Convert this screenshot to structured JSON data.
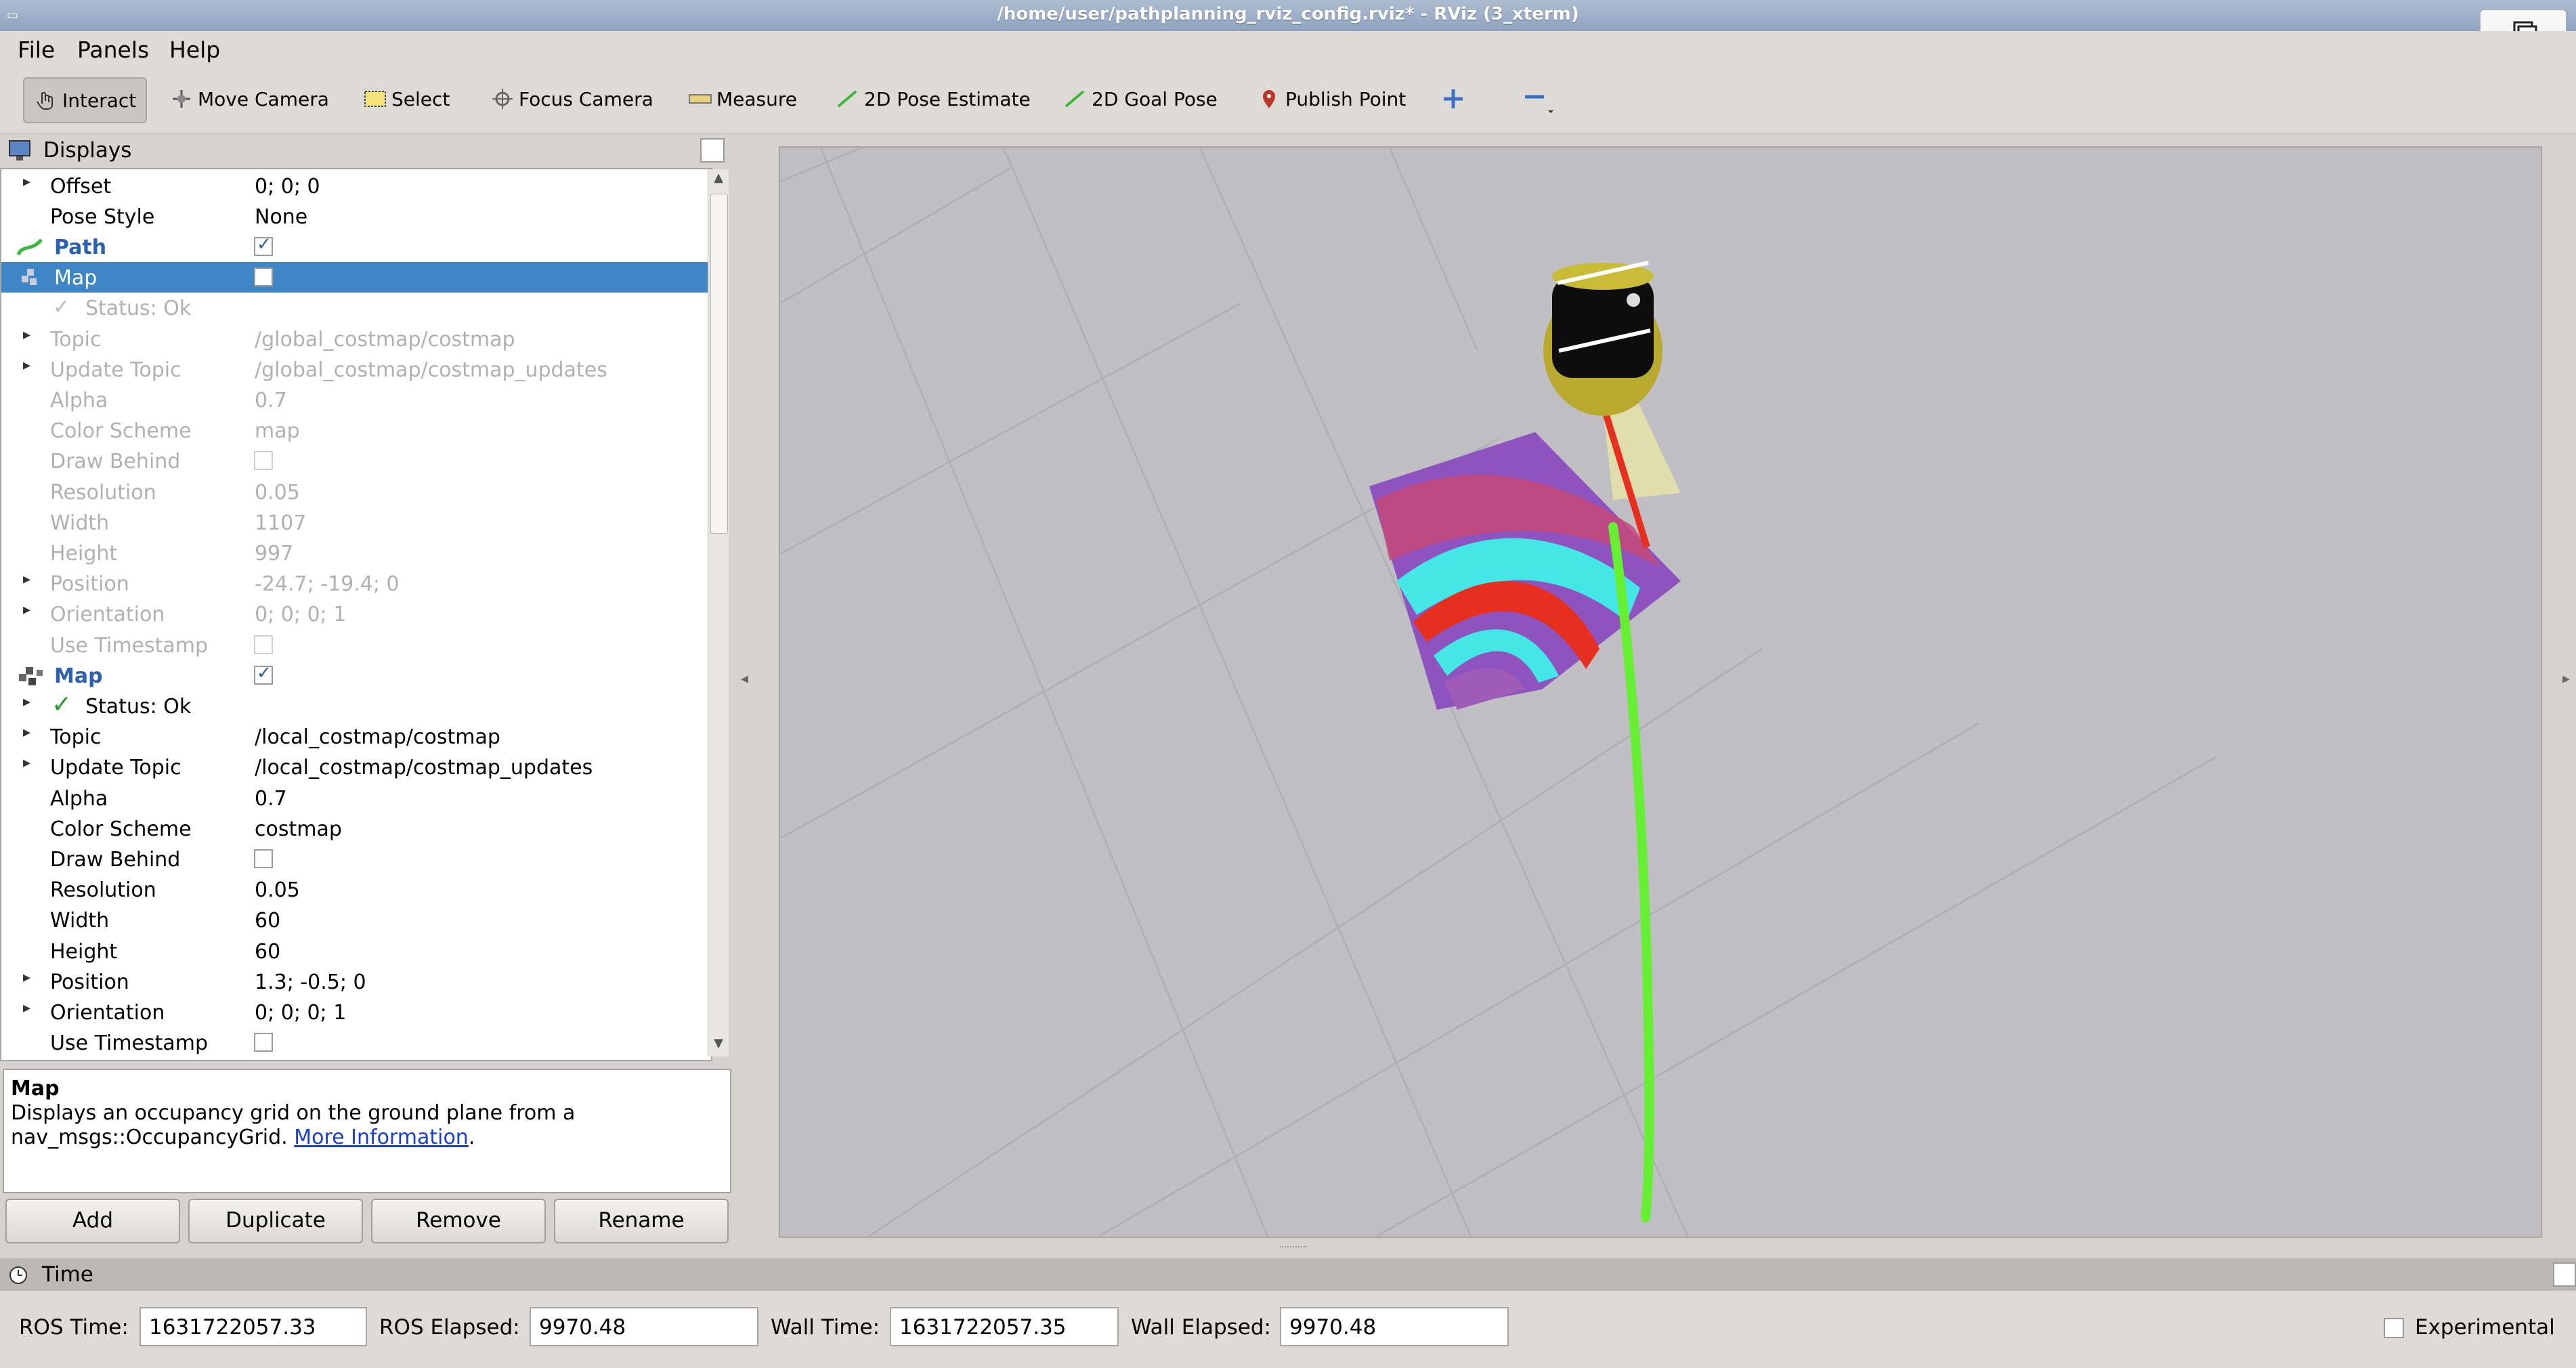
{
  "window": {
    "title": "/home/user/pathplanning_rviz_config.rviz* - RViz (3_xterm)"
  },
  "menu": [
    "File",
    "Panels",
    "Help"
  ],
  "toolbar": {
    "tools": [
      "Interact",
      "Move Camera",
      "Select",
      "Focus Camera",
      "Measure",
      "2D Pose Estimate",
      "2D Goal Pose",
      "Publish Point"
    ],
    "active": "Interact"
  },
  "displays": {
    "title": "Displays",
    "rows": [
      {
        "name": "Offset",
        "value": "0; 0; 0"
      },
      {
        "name": "Pose Style",
        "value": "None"
      },
      {
        "name": "Path",
        "checked": true
      },
      {
        "name": "Map",
        "checked": false
      },
      {
        "name": "Status: Ok"
      },
      {
        "name": "Topic",
        "value": "/global_costmap/costmap"
      },
      {
        "name": "Update Topic",
        "value": "/global_costmap/costmap_updates"
      },
      {
        "name": "Alpha",
        "value": "0.7"
      },
      {
        "name": "Color Scheme",
        "value": "map"
      },
      {
        "name": "Draw Behind",
        "checked": false
      },
      {
        "name": "Resolution",
        "value": "0.05"
      },
      {
        "name": "Width",
        "value": "1107"
      },
      {
        "name": "Height",
        "value": "997"
      },
      {
        "name": "Position",
        "value": "-24.7; -19.4; 0"
      },
      {
        "name": "Orientation",
        "value": "0; 0; 0; 1"
      },
      {
        "name": "Use Timestamp",
        "checked": false
      },
      {
        "name": "Map",
        "checked": true
      },
      {
        "name": "Status: Ok"
      },
      {
        "name": "Topic",
        "value": "/local_costmap/costmap"
      },
      {
        "name": "Update Topic",
        "value": "/local_costmap/costmap_updates"
      },
      {
        "name": "Alpha",
        "value": "0.7"
      },
      {
        "name": "Color Scheme",
        "value": "costmap"
      },
      {
        "name": "Draw Behind",
        "checked": false
      },
      {
        "name": "Resolution",
        "value": "0.05"
      },
      {
        "name": "Width",
        "value": "60"
      },
      {
        "name": "Height",
        "value": "60"
      },
      {
        "name": "Position",
        "value": "1.3; -0.5; 0"
      },
      {
        "name": "Orientation",
        "value": "0; 0; 0; 1"
      },
      {
        "name": "Use Timestamp",
        "checked": false
      }
    ]
  },
  "description": {
    "title": "Map",
    "text": "Displays an occupancy grid on the ground plane from a nav_msgs::OccupancyGrid.",
    "link": "More Information"
  },
  "buttons": [
    "Add",
    "Duplicate",
    "Remove",
    "Rename"
  ],
  "time": {
    "title": "Time",
    "ros_time_label": "ROS Time:",
    "ros_time": "1631722057.33",
    "ros_elapsed_label": "ROS Elapsed:",
    "ros_elapsed": "9970.48",
    "wall_time_label": "Wall Time:",
    "wall_time": "1631722057.35",
    "wall_elapsed_label": "Wall Elapsed:",
    "wall_elapsed": "9970.48",
    "experimental": "Experimental",
    "experimental_checked": false
  },
  "colors": {
    "selection": "#3f86c7",
    "path": "#66ee33",
    "heading": "#e53020",
    "costmap_cyan": "#44e6e6",
    "costmap_purple": "#8a4fc0"
  }
}
